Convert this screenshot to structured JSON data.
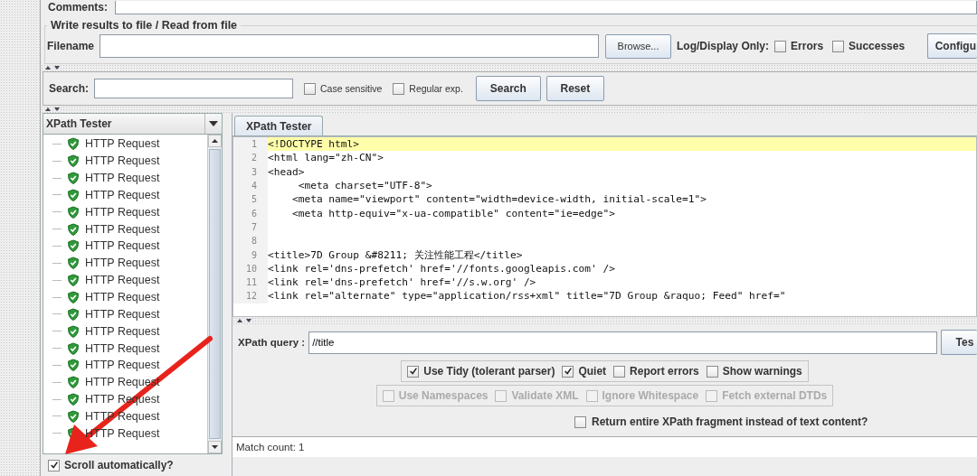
{
  "comments": {
    "label": "Comments:"
  },
  "file_group": {
    "title": "Write results to file / Read from file",
    "filename_label": "Filename",
    "browse_button": "Browse...",
    "log_label": "Log/Display Only:",
    "filters": [
      {
        "label": "Errors",
        "checked": false
      },
      {
        "label": "Successes",
        "checked": false
      }
    ],
    "configure_button": "Configu"
  },
  "search": {
    "label": "Search:",
    "options": [
      {
        "label": "Case sensitive",
        "checked": false
      },
      {
        "label": "Regular exp.",
        "checked": false
      }
    ],
    "buttons": [
      "Search",
      "Reset"
    ]
  },
  "sidebar": {
    "renderer": "XPath Tester",
    "items": [
      {
        "label": "HTTP Request"
      },
      {
        "label": "HTTP Request"
      },
      {
        "label": "HTTP Request"
      },
      {
        "label": "HTTP Request"
      },
      {
        "label": "HTTP Request"
      },
      {
        "label": "HTTP Request"
      },
      {
        "label": "HTTP Request"
      },
      {
        "label": "HTTP Request"
      },
      {
        "label": "HTTP Request"
      },
      {
        "label": "HTTP Request"
      },
      {
        "label": "HTTP Request"
      },
      {
        "label": "HTTP Request"
      },
      {
        "label": "HTTP Request"
      },
      {
        "label": "HTTP Request"
      },
      {
        "label": "HTTP Request"
      },
      {
        "label": "HTTP Request"
      },
      {
        "label": "HTTP Request"
      },
      {
        "label": "HTTP Request"
      }
    ],
    "scroll_auto": {
      "label": "Scroll automatically?",
      "checked": true
    }
  },
  "tab": {
    "label": "XPath Tester",
    "selected": true
  },
  "editor": {
    "lines": [
      {
        "number": "1",
        "text": "<!DOCTYPE html>",
        "highlighted": true
      },
      {
        "number": "2",
        "text": "<html lang=\"zh-CN\">",
        "highlighted": false
      },
      {
        "number": "3",
        "text": "<head>",
        "highlighted": false
      },
      {
        "number": "4",
        "text": "     <meta charset=\"UTF-8\">",
        "highlighted": false
      },
      {
        "number": "5",
        "text": "    <meta name=\"viewport\" content=\"width=device-width, initial-scale=1\">",
        "highlighted": false
      },
      {
        "number": "6",
        "text": "    <meta http-equiv=\"x-ua-compatible\" content=\"ie=edge\">",
        "highlighted": false
      },
      {
        "number": "7",
        "highlighted": false
      },
      {
        "number": "8",
        "highlighted": false
      },
      {
        "number": "9",
        "text": "<title>7D Group &#8211; 关注性能工程</title>",
        "highlighted": false
      },
      {
        "number": "10",
        "text": "<link rel='dns-prefetch' href='//fonts.googleapis.com' />",
        "highlighted": false
      },
      {
        "number": "11",
        "text": "<link rel='dns-prefetch' href='//s.w.org' />",
        "highlighted": false
      },
      {
        "number": "12",
        "text": "<link rel=\"alternate\" type=\"application/rss+xml\" title=\"7D Group &raquo; Feed\" href=\"",
        "highlighted": false
      }
    ]
  },
  "xpath": {
    "label": "XPath query :",
    "value": "//title",
    "test_button": "Tes",
    "options": [
      {
        "label": "Use Tidy (tolerant parser)",
        "checked": true,
        "disabled": false
      },
      {
        "label": "Quiet",
        "checked": true,
        "disabled": false
      },
      {
        "label": "Report errors",
        "checked": false,
        "disabled": false
      },
      {
        "label": "Show warnings",
        "checked": false,
        "disabled": false
      }
    ],
    "advanced": [
      {
        "label": "Use Namespaces",
        "checked": false,
        "disabled": true
      },
      {
        "label": "Validate XML",
        "checked": false,
        "disabled": true
      },
      {
        "label": "Ignore Whitespace",
        "checked": false,
        "disabled": true
      },
      {
        "label": "Fetch external DTDs",
        "checked": false,
        "disabled": true
      }
    ],
    "fragment": {
      "label": "Return entire XPath fragment instead of text content?",
      "checked": false
    }
  },
  "match_count": "Match count: 1"
}
